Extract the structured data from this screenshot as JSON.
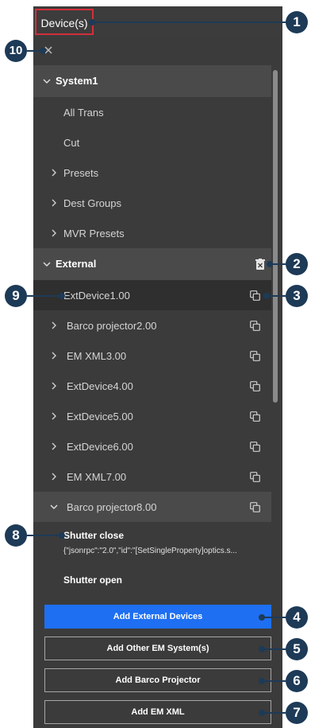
{
  "title": "Device(s)",
  "tree": {
    "system1": {
      "label": "System1",
      "items": [
        "All Trans",
        "Cut",
        "Presets",
        "Dest Groups",
        "MVR Presets"
      ]
    },
    "external": {
      "label": "External",
      "devices": [
        "ExtDevice1.00",
        "Barco projector2.00",
        "EM XML3.00",
        "ExtDevice4.00",
        "ExtDevice5.00",
        "ExtDevice6.00",
        "EM XML7.00",
        "Barco projector8.00"
      ]
    },
    "barco8_actions": [
      {
        "title": "Shutter close",
        "detail": "{\"jsonrpc\":\"2.0\",\"id\":\"[SetSingleProperty]optics.s..."
      },
      {
        "title": "Shutter open"
      }
    ]
  },
  "buttons": {
    "add_external": "Add External Devices",
    "add_other_em": "Add Other EM System(s)",
    "add_barco": "Add Barco Projector",
    "add_em_xml": "Add EM XML"
  },
  "callouts": [
    "1",
    "2",
    "3",
    "4",
    "5",
    "6",
    "7",
    "8",
    "9",
    "10"
  ],
  "colors": {
    "panel": "#3b3b3b",
    "selected_row": "#2f2f2f",
    "header_row": "#4a4a4a",
    "primary_button": "#1e6ff2",
    "callout": "#1d3a57",
    "title_highlight": "#d32f3a"
  }
}
